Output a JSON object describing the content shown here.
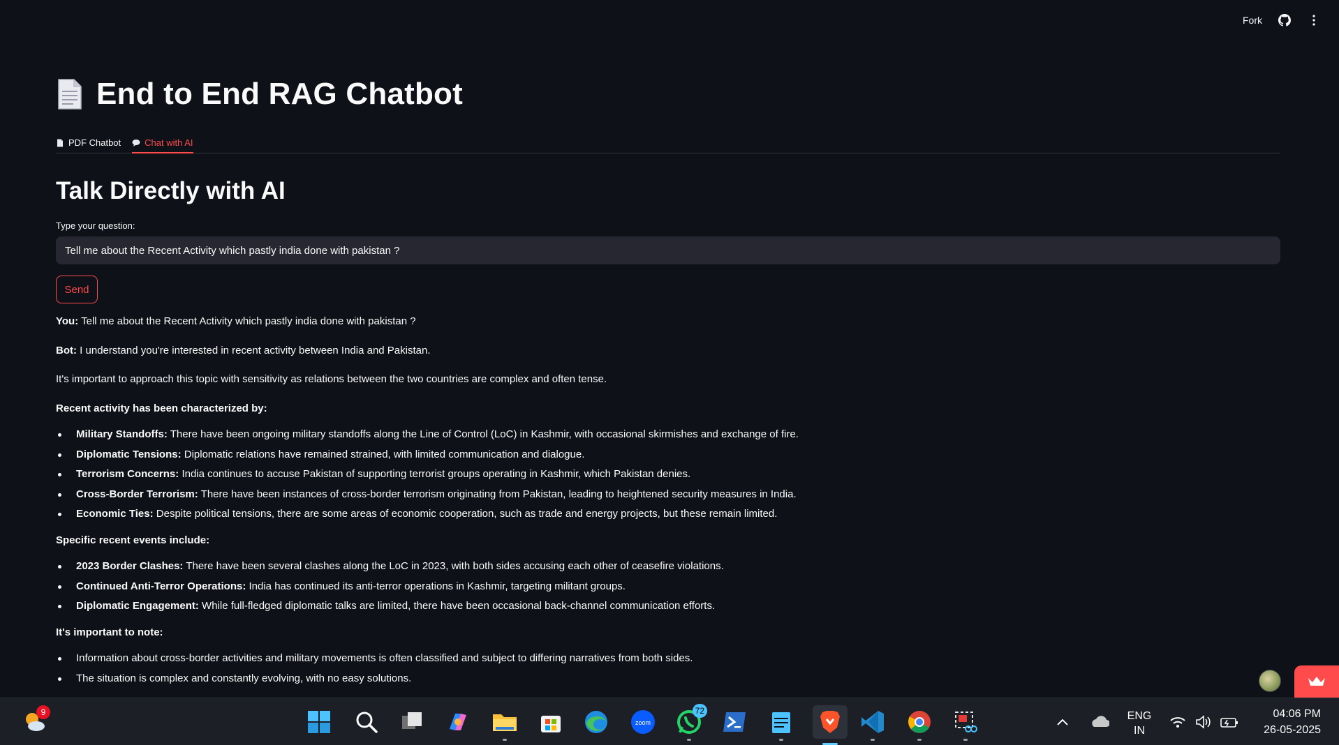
{
  "header": {
    "fork_label": "Fork"
  },
  "page": {
    "title": "End to End RAG Chatbot",
    "tabs": [
      {
        "label": "PDF Chatbot",
        "active": false
      },
      {
        "label": "Chat with AI",
        "active": true
      }
    ],
    "section_title": "Talk Directly with AI",
    "input_label": "Type your question:",
    "input_value": "Tell me about the Recent Activity which pastly india done with pakistan ?",
    "send_label": "Send"
  },
  "chat": {
    "user_prefix": "You:",
    "user_message": "Tell me about the Recent Activity which pastly india done with pakistan ?",
    "bot_prefix": "Bot:",
    "bot_intro": "I understand you're interested in recent activity between India and Pakistan.",
    "bot_para": "It's important to approach this topic with sensitivity as relations between the two countries are complex and often tense.",
    "heading1": "Recent activity has been characterized by:",
    "list1": [
      {
        "term": "Military Standoffs:",
        "text": "There have been ongoing military standoffs along the Line of Control (LoC) in Kashmir, with occasional skirmishes and exchange of fire."
      },
      {
        "term": "Diplomatic Tensions:",
        "text": "Diplomatic relations have remained strained, with limited communication and dialogue."
      },
      {
        "term": "Terrorism Concerns:",
        "text": "India continues to accuse Pakistan of supporting terrorist groups operating in Kashmir, which Pakistan denies."
      },
      {
        "term": "Cross-Border Terrorism:",
        "text": "There have been instances of cross-border terrorism originating from Pakistan, leading to heightened security measures in India."
      },
      {
        "term": "Economic Ties:",
        "text": "Despite political tensions, there are some areas of economic cooperation, such as trade and energy projects, but these remain limited."
      }
    ],
    "heading2": "Specific recent events include:",
    "list2": [
      {
        "term": "2023 Border Clashes:",
        "text": "There have been several clashes along the LoC in 2023, with both sides accusing each other of ceasefire violations."
      },
      {
        "term": "Continued Anti-Terror Operations:",
        "text": "India has continued its anti-terror operations in Kashmir, targeting militant groups."
      },
      {
        "term": "Diplomatic Engagement:",
        "text": "While full-fledged diplomatic talks are limited, there have been occasional back-channel communication efforts."
      }
    ],
    "heading3": "It's important to note:",
    "list3": [
      {
        "text": "Information about cross-border activities and military movements is often classified and subject to differing narratives from both sides."
      },
      {
        "text": "The situation is complex and constantly evolving, with no easy solutions."
      }
    ]
  },
  "taskbar": {
    "weather_badge": "9",
    "whatsapp_badge": "72",
    "lang_line1": "ENG",
    "lang_line2": "IN",
    "time": "04:06 PM",
    "date": "26-05-2025"
  },
  "colors": {
    "background": "#0e1117",
    "accent": "#ff4b4b",
    "input_bg": "#262730"
  }
}
